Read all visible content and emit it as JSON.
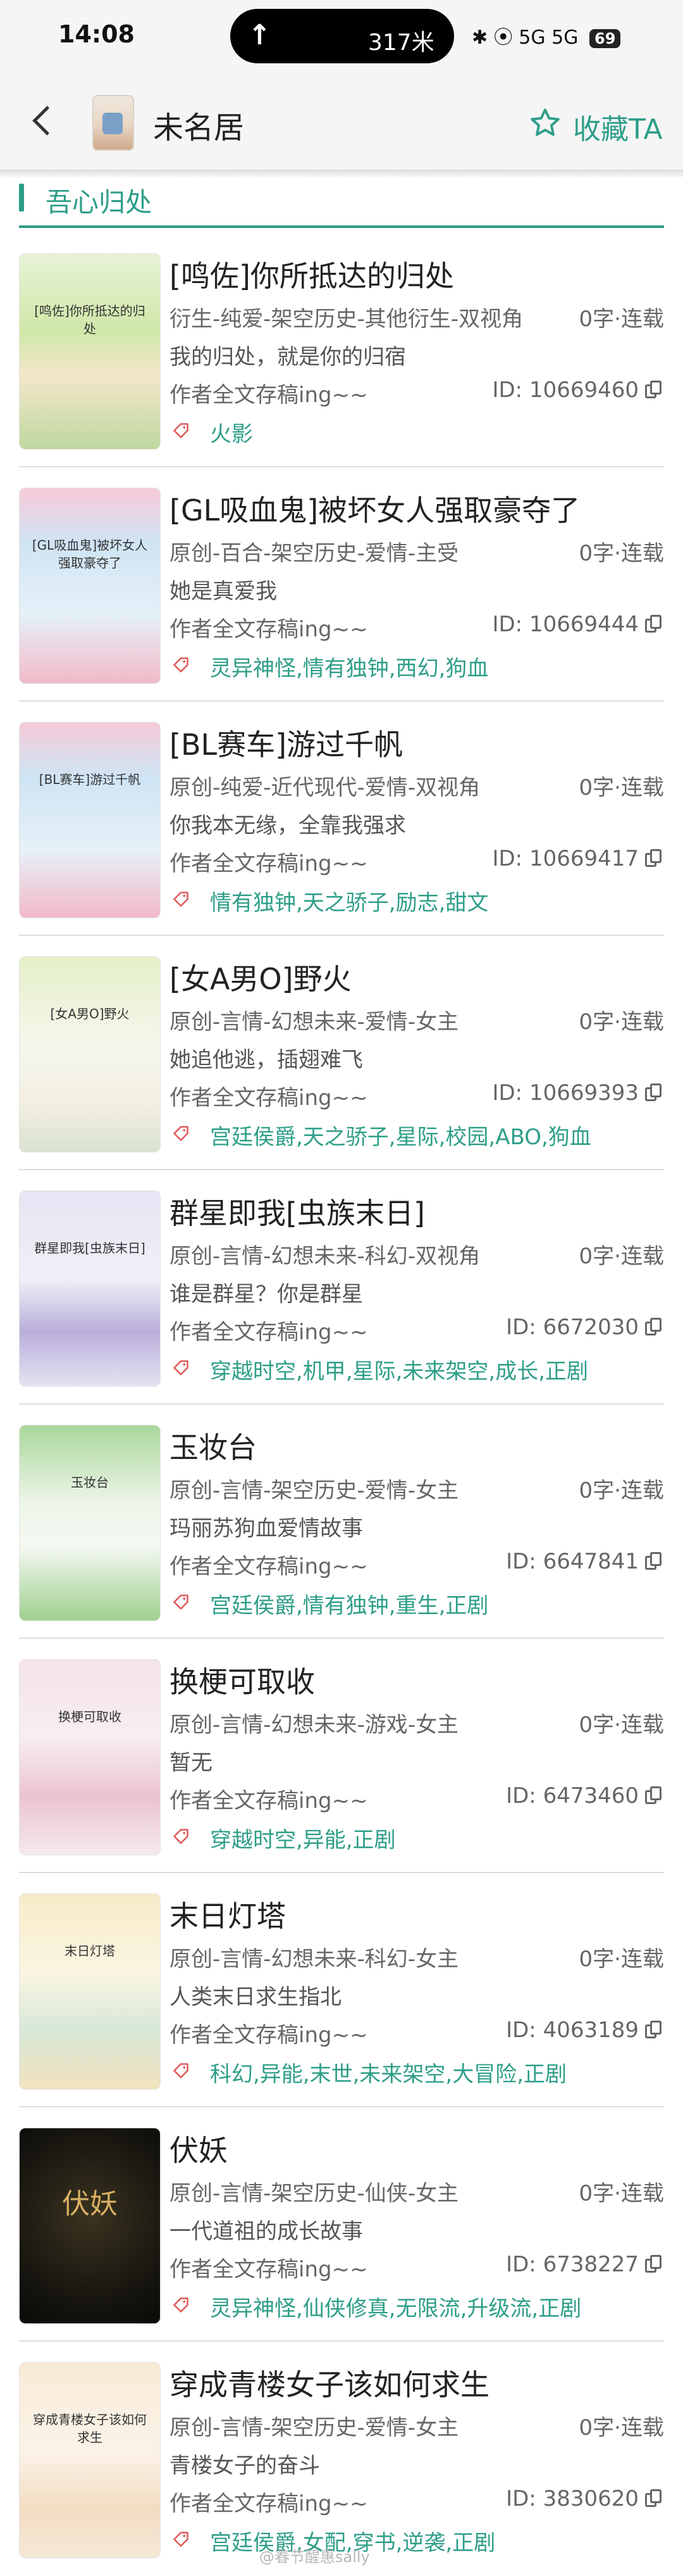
{
  "status_bar": {
    "time": "14:08",
    "speed": "317米",
    "network": "5G 5G",
    "battery": "69"
  },
  "header": {
    "title": "未名居",
    "favorite_label": "收藏TA"
  },
  "section": {
    "title": "吾心归处"
  },
  "colors": {
    "accent": "#2e9e88",
    "tag": "#2e9e88",
    "divider": "#dddddd"
  },
  "books": [
    {
      "title": "[鸣佐]你所抵达的归处",
      "cover_title": "[鸣佐]你所抵达的归处",
      "genre": "衍生-纯爱-架空历史-其他衍生-双视角",
      "stats": "0字·连载",
      "summary": "我的归处，就是你的归宿",
      "author": "作者全文存稿ing~~",
      "id": "ID: 10669460",
      "tags": "火影",
      "cover_bg": "linear-gradient(180deg,#e8f3d6 0%,#cfe7a8 40%,#f3e7c9 62%,#bfd8a0 100%)"
    },
    {
      "title": "[GL吸血鬼]被坏女人强取豪夺了",
      "cover_title": "[GL吸血鬼]被坏女人强取豪夺了",
      "genre": "原创-百合-架空历史-爱情-主受",
      "stats": "0字·连载",
      "summary": "她是真爱我",
      "author": "作者全文存稿ing~~",
      "id": "ID: 10669444",
      "tags": "灵异神怪,情有独钟,西幻,狗血",
      "cover_bg": "linear-gradient(180deg,#f7cad8 0%,#cfe4f4 28%,#e6f1f8 65%,#f2b9c8 100%)"
    },
    {
      "title": "[BL赛车]游过千帆",
      "cover_title": "[BL赛车]游过千帆",
      "genre": "原创-纯爱-近代现代-爱情-双视角",
      "stats": "0字·连载",
      "summary": "你我本无缘，全靠我强求",
      "author": "作者全文存稿ing~~",
      "id": "ID: 10669417",
      "tags": "情有独钟,天之骄子,励志,甜文",
      "cover_bg": "linear-gradient(180deg,#f7cad8 0%,#cfe4f4 28%,#e6f1f8 65%,#f2b9c8 100%)"
    },
    {
      "title": "[女A男O]野火",
      "cover_title": "[女A男O]野火",
      "genre": "原创-言情-幻想未来-爱情-女主",
      "stats": "0字·连载",
      "summary": "她追他逃，插翅难飞",
      "author": "作者全文存稿ing~~",
      "id": "ID: 10669393",
      "tags": "宫廷侯爵,天之骄子,星际,校园,ABO,狗血",
      "cover_bg": "linear-gradient(180deg,#e4f0c8 0%,#f6f7ec 45%,#f3efe2 75%,#d9e2d0 100%)"
    },
    {
      "title": "群星即我[虫族末日]",
      "cover_title": "群星即我[虫族末日]",
      "genre": "原创-言情-幻想未来-科幻-双视角",
      "stats": "0字·连载",
      "summary": "谁是群星？你是群星",
      "author": "作者全文存稿ing~~",
      "id": "ID: 6672030",
      "tags": "穿越时空,机甲,星际,未来架空,成长,正剧",
      "cover_bg": "linear-gradient(180deg,#e8e4f3 0%,#f1eff8 45%,#b9aedb 72%,#e6e2f0 100%)"
    },
    {
      "title": "玉妆台",
      "cover_title": "玉妆台",
      "genre": "原创-言情-架空历史-爱情-女主",
      "stats": "0字·连载",
      "summary": "玛丽苏狗血爱情故事",
      "author": "作者全文存稿ing~~",
      "id": "ID: 6647841",
      "tags": "宫廷侯爵,情有独钟,重生,正剧",
      "cover_bg": "linear-gradient(180deg,#a9d79a 0%,#eef6ea 40%,#f4f8f2 62%,#9fd08f 100%)"
    },
    {
      "title": "换梗可取收",
      "cover_title": "换梗可取收",
      "genre": "原创-言情-幻想未来-游戏-女主",
      "stats": "0字·连载",
      "summary": "暂无",
      "author": "作者全文存稿ing~~",
      "id": "ID: 6473460",
      "tags": "穿越时空,异能,正剧",
      "cover_bg": "linear-gradient(180deg,#f3e3ea 0%,#f8eef2 40%,#eac3d2 70%,#f5e9ee 100%)"
    },
    {
      "title": "末日灯塔",
      "cover_title": "末日灯塔",
      "genre": "原创-言情-幻想未来-科幻-女主",
      "stats": "0字·连载",
      "summary": "人类末日求生指北",
      "author": "作者全文存稿ing~~",
      "id": "ID: 4063189",
      "tags": "科幻,异能,末世,未来架空,大冒险,正剧",
      "cover_bg": "linear-gradient(180deg,#f7ecc8 0%,#fbf5e2 40%,#d7e8d8 70%,#f1e3bc 100%)"
    },
    {
      "title": "伏妖",
      "cover_title": "伏妖",
      "genre": "原创-言情-架空历史-仙侠-女主",
      "stats": "0字·连载",
      "summary": "一代道祖的成长故事",
      "author": "作者全文存稿ing~~",
      "id": "ID: 6738227",
      "tags": "灵异神怪,仙侠修真,无限流,升级流,正剧",
      "cover_bg": "radial-gradient(circle at 50% 45%,#3a3320 0%,#15130e 70%,#0b0a08 100%)"
    },
    {
      "title": "穿成青楼女子该如何求生",
      "cover_title": "穿成青楼女子该如何求生",
      "genre": "原创-言情-架空历史-爱情-女主",
      "stats": "0字·连载",
      "summary": "青楼女子的奋斗",
      "author": "作者全文存稿ing~~",
      "id": "ID: 3830620",
      "tags": "宫廷侯爵,女配,穿书,逆袭,正剧",
      "cover_bg": "linear-gradient(180deg,#f8ead6 0%,#fbf3e8 45%,#f2dcc2 75%,#f6e8d8 100%)"
    }
  ],
  "watermark": "@春节醒惠sally"
}
